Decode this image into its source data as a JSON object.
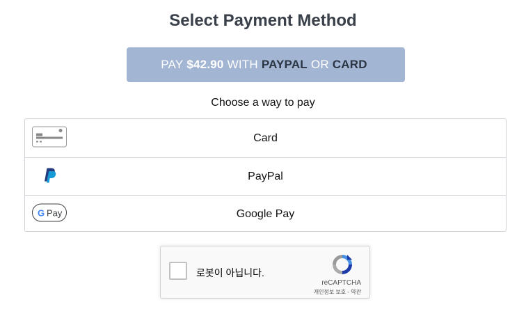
{
  "header": {
    "title": "Select Payment Method"
  },
  "pay_button": {
    "prefix": "PAY",
    "amount": "$42.90",
    "with": "WITH",
    "brand1": "PAYPAL",
    "or": "OR",
    "brand2": "CARD",
    "bg_color": "#a2b5d2"
  },
  "chooser": {
    "label": "Choose a way to pay",
    "methods": [
      {
        "label": "Card",
        "icon": "card-icon"
      },
      {
        "label": "PayPal",
        "icon": "paypal-logo-icon"
      },
      {
        "label": "Google Pay",
        "icon": "google-pay-icon",
        "icon_text": "Pay"
      }
    ]
  },
  "captcha": {
    "label": "로봇이 아닙니다.",
    "brand": "reCAPTCHA",
    "terms": "개인정보 보호 - 약관",
    "icon": "recaptcha-logo-icon"
  }
}
